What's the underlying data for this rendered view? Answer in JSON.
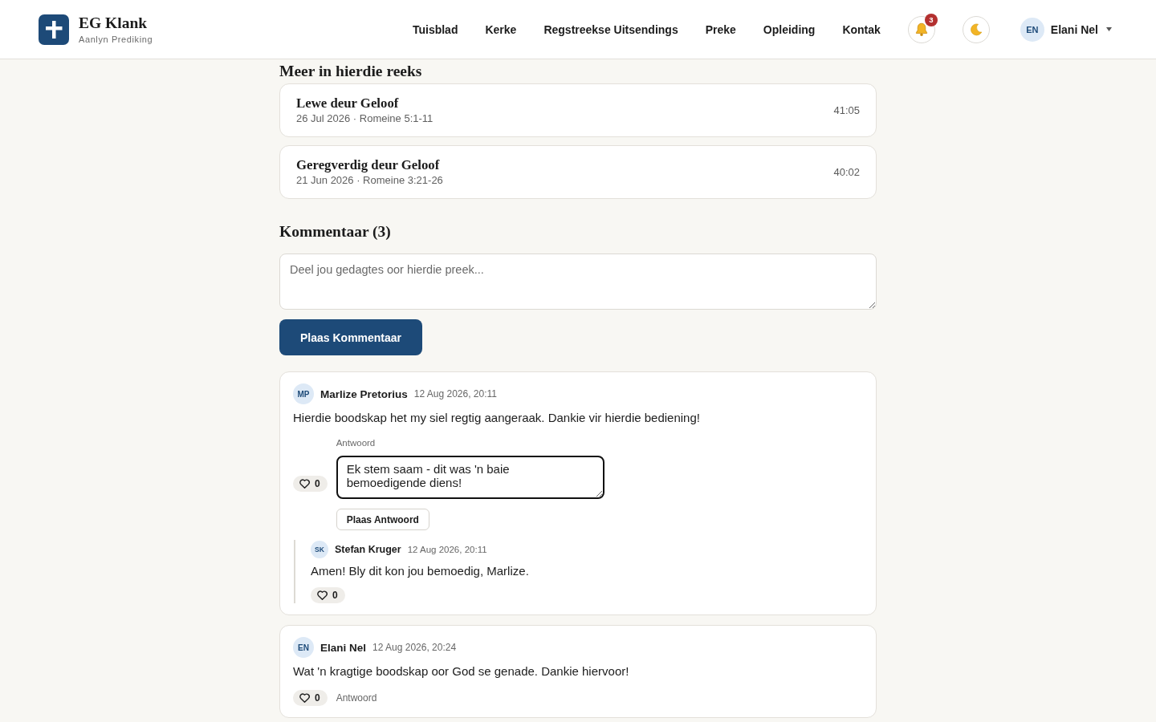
{
  "header": {
    "brand": {
      "name": "EG Klank",
      "tagline": "Aanlyn Prediking"
    },
    "nav": [
      "Tuisblad",
      "Kerke",
      "Regstreekse Uitsendings",
      "Preke",
      "Opleiding",
      "Kontak"
    ],
    "notifications": {
      "badge": "3"
    },
    "user": {
      "initials": "EN",
      "name": "Elani Nel"
    }
  },
  "series": {
    "title": "Meer in hierdie reeks",
    "sermons": [
      {
        "title": "Lewe deur Geloof",
        "meta": "26 Jul 2026 · Romeine 5:1-11",
        "duration": "41:05"
      },
      {
        "title": "Geregverdig deur Geloof",
        "meta": "21 Jun 2026 · Romeine 3:21-26",
        "duration": "40:02"
      }
    ]
  },
  "comments": {
    "title": "Kommentaar (3)",
    "field": {
      "placeholder": "Deel jou gedagtes oor hierdie preek..."
    },
    "submit": "Plaas Kommentaar",
    "items": [
      {
        "initials": "MP",
        "author": "Marlize Pretorius",
        "time": "12 Aug 2026, 20:11",
        "text": "Hierdie boodskap het my siel regtig aangeraak. Dankie vir hierdie bediening!",
        "likes": "0",
        "reply_form": {
          "label": "Antwoord",
          "value": "Ek stem saam - dit was 'n baie bemoedigende diens!",
          "focused": true,
          "button": "Plaas Antwoord"
        },
        "replies": [
          {
            "initials": "SK",
            "author": "Stefan Kruger",
            "time": "12 Aug 2026, 20:11",
            "text": "Amen! Bly dit kon jou bemoedig, Marlize.",
            "likes": "0"
          }
        ]
      },
      {
        "initials": "EN",
        "author": "Elani Nel",
        "time": "12 Aug 2026, 20:24",
        "text": "Wat 'n kragtige boodskap oor God se genade. Dankie hiervoor!",
        "likes": "0",
        "reply_link": "Antwoord"
      }
    ]
  }
}
